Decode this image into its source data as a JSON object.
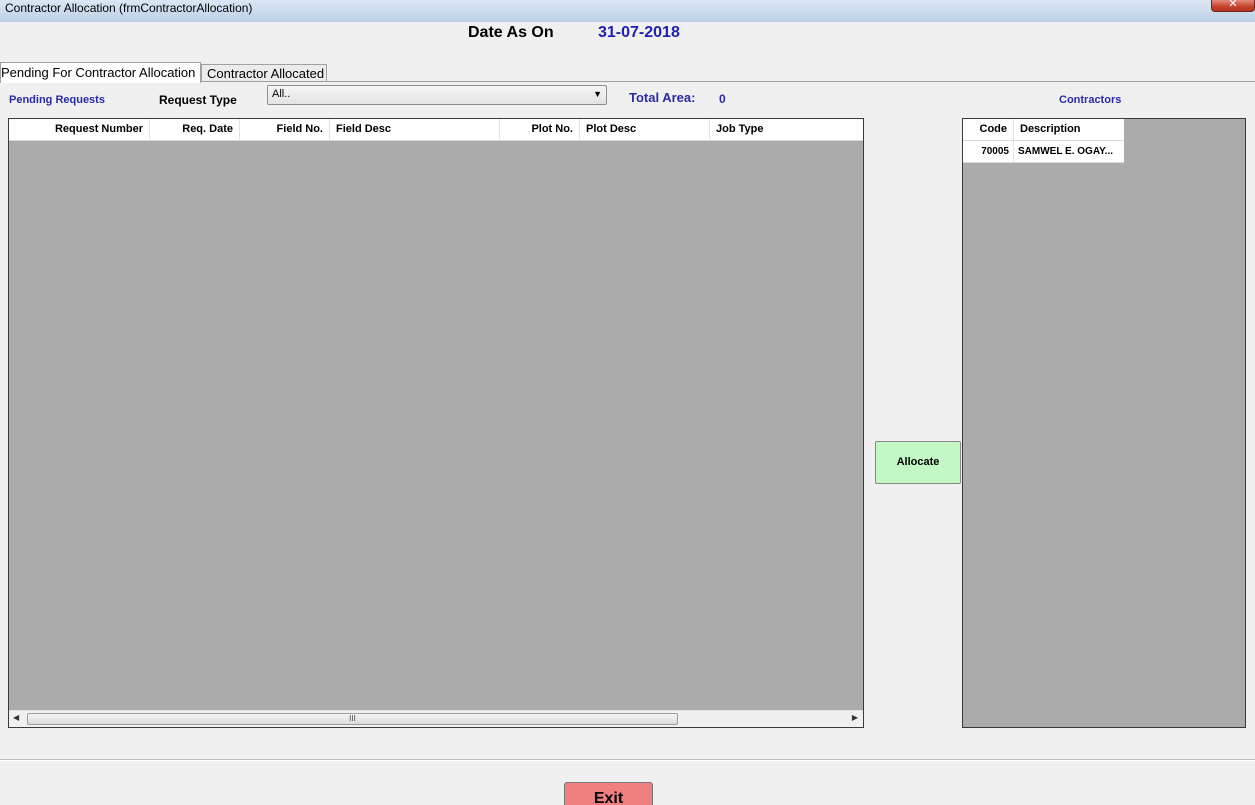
{
  "window": {
    "title": "Contractor Allocation (frmContractorAllocation)",
    "close_glyph": "✕"
  },
  "header": {
    "date_label": "Date As On",
    "date_value": "31-07-2018"
  },
  "tabs": [
    {
      "label": "Pending For Contractor Allocation",
      "active": true
    },
    {
      "label": "Contractor Allocated",
      "active": false
    }
  ],
  "filters": {
    "pending_requests_label": "Pending Requests",
    "request_type_label": "Request Type",
    "request_type_value": "All..",
    "total_area_label": "Total Area:",
    "total_area_value": "0",
    "contractors_label": "Contractors"
  },
  "requests_grid": {
    "columns": [
      "Request Number",
      "Req. Date",
      "Field No.",
      "Field Desc",
      "Plot No.",
      "Plot Desc",
      "Job Type"
    ],
    "rows": [],
    "scroll_thumb_glyph": "III"
  },
  "contractors_grid": {
    "columns": [
      "Code",
      "Description"
    ],
    "rows": [
      {
        "code": "70005",
        "description": "SAMWEL E. OGAY..."
      }
    ]
  },
  "buttons": {
    "allocate": "Allocate",
    "exit": "Exit"
  },
  "colors": {
    "accent_blue": "#1f1fb3",
    "allocate_bg": "#c3f7c3",
    "exit_bg": "#f08080",
    "grid_bg": "#ababab"
  }
}
